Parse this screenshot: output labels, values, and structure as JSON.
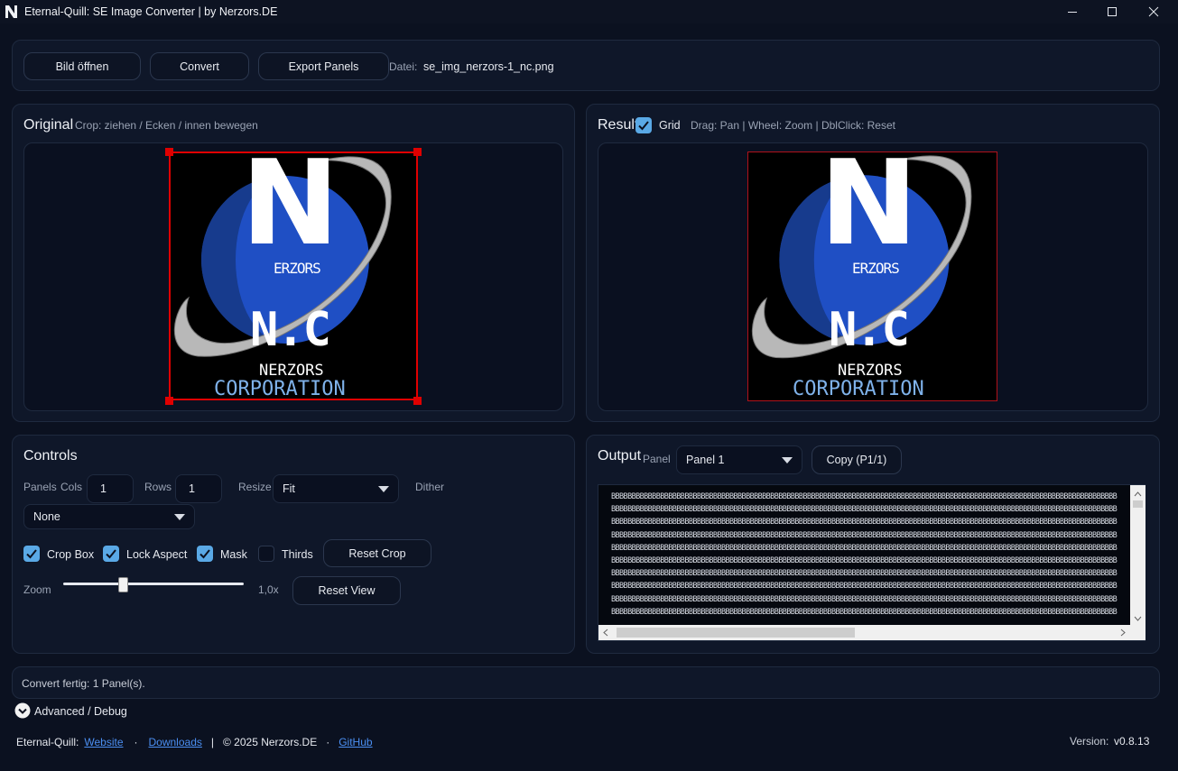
{
  "window": {
    "title": "Eternal-Quill: SE Image Converter | by Nerzors.DE"
  },
  "toolbar": {
    "open_label": "Bild öffnen",
    "convert_label": "Convert",
    "export_label": "Export Panels",
    "file_label": "Datei:",
    "file_name": "se_img_nerzors-1_nc.png"
  },
  "original": {
    "title": "Original",
    "hint": "Crop: ziehen / Ecken / innen bewegen"
  },
  "result": {
    "title": "Result",
    "grid_label": "Grid",
    "grid_checked": true,
    "hint": "Drag: Pan | Wheel: Zoom | DblClick: Reset"
  },
  "logo": {
    "big_letter": "N",
    "erzors": "ERZORS",
    "nc": "N.C",
    "nerzors": "NERZORS",
    "corporation": "CORPORATION"
  },
  "controls": {
    "title": "Controls",
    "panels_label": "Panels",
    "cols_label": "Cols",
    "cols_value": "1",
    "rows_label": "Rows",
    "rows_value": "1",
    "resize_label": "Resize",
    "resize_value": "Fit",
    "dither_label": "Dither",
    "dither_value": "None",
    "crop_box_label": "Crop Box",
    "lock_aspect_label": "Lock Aspect",
    "mask_label": "Mask",
    "thirds_label": "Thirds",
    "reset_crop_label": "Reset Crop",
    "zoom_label": "Zoom",
    "zoom_value": "1,0x",
    "zoom_fraction": 0.33,
    "reset_view_label": "Reset View",
    "checks": {
      "crop_box": true,
      "lock_aspect": true,
      "mask": true,
      "thirds": false
    }
  },
  "output": {
    "title": "Output",
    "panel_label": "Panel",
    "panel_value": "Panel 1",
    "copy_label": "Copy (P1/1)",
    "lines": [
      "BBBBBBBBBBBBBBBBBBBBBBBBBBBBBBBBBBBBBBBBBBBBBBBBBBBBBBBBBBBBBBBBBBBBBBBBBBBBBBBBBBBBBBBBBBBBBBBBBBBBBBBBBBBBBBBBBBBBBBBBBBBB",
      "BBBBBBBBBBBBBBBBBBBBBBBBBBBBBBBBBBBBBBBBBBBBBBBBBBBBBBBBBBBBBBBBBBBBBBBBBBBBBBBBBBBBBBBBBBBBBBBBBBBBBBBBBBBBBBBBBBBBBBBBBBBB",
      "BBBBBBBBBBBBBBBBBBBBBBBBBBBBBBBBBBBBBBBBBBBBBBBBBBBBBBBBBBBBBBBBBBBBBBBBBBBBBBBBBBBBBBBBBBBBBBBBBBBBBBBBBBBBBBBBBBBBBBBBBBBB",
      "BBBBBBBBBBBBBBBBBBBBBBBBBBBBBBBBBBBBBBBBBBBBBBBBBBBBBBBBBBBBBBBBBBBBBBBBBBBBBBBBBBBBBBBBBBBBBBBBBBBBBBBBBBBBBBBBBBBBBBBBBBBB",
      "BBBBBBBBBBBBBBBBBBBBBBBBBBBBBBBBBBBBBBBBBBBBBBBBBBBBBBBBBBBBBBBBBBBBBBBBBBBBBBBBBBBBBBBBBBBBBBBBBBBBBBBBBBBBBBBBBBBBBBBBBBBB",
      "BBBBBBBBBBBBBBBBBBBBBBBBBBBBBBBBBBBBBBBBBBBBBBBBBBBBBBBBBBBBBBBBBBBBBBBBBBBBBBBBBBBBBBBBBBBBBBBBBBBBBBBBBBBBBBBBBBBBBBBBBBBB",
      "BBBBBBBBBBBBBBBBBBBBBBBBBBBBBBBBBBBBBBBBBBBBBBBBBBBBBBBBBBBBBBBBBBBBBBBBBBBBBBBBBBBBBBBBBBBBBBBBBBBBBBBBBBBBBBBBBBBBBBBBBBBB",
      "BBBBBBBBBBBBBBBBBBBBBBBBBBBBBBBBBBBBBBBBBBBBBBBBBBBBBBBBBBBBBBBBBBBBBBBBBBBBBBBBBBBBBBBBBBBBBBBBBBBBBBBBBBBBBBBBBBBBBBBBBBBB",
      "BBBBBBBBBBBBBBBBBBBBBBBBBBBBBBBBBBBBBBBBBBBBBBBBBBBBBBBBBBBBBBBBBBBBBBBBBBBBBBBBBBBBBBBBBBBBBBBBBBBBBBBBBBBBBBBBBBBBBBBBBBBB",
      "BBBBBBBBBBBBBBBBBBBBBBBBBBBBBBBBBBBBBBBBBBBBBBBBBBBBBBBBBBBBBBBBBBBBBBBBBBBBBBBBBBBBBBBBBBBBBBBBBBBBBBBBBBBBBBBBBBBBBBBBBBBB"
    ]
  },
  "status": {
    "message": "Convert fertig: 1 Panel(s)."
  },
  "advanced": {
    "label": "Advanced / Debug"
  },
  "footer": {
    "brand": "Eternal-Quill:",
    "website": "Website",
    "sep1": "·",
    "downloads": "Downloads",
    "sep2": "|",
    "copyright": "© 2025 Nerzors.DE",
    "sep3": "·",
    "github": "GitHub",
    "version_label": "Version:",
    "version_value": "v0.8.13"
  },
  "colors": {
    "accent": "#5aa9e6",
    "crop": "#e00000",
    "result_frame": "#b0121b",
    "link": "#4b8ff2",
    "logo_blue": "#1f4fc4",
    "logo_blue_dark": "#15367f",
    "logo_text_blue": "#7fb2ea"
  }
}
